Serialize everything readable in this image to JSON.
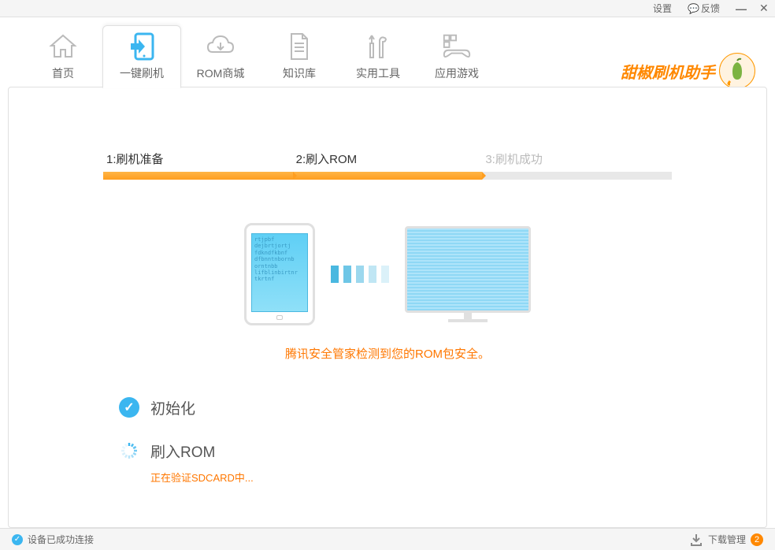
{
  "titlebar": {
    "settings": "设置",
    "feedback": "反馈"
  },
  "nav": {
    "tabs": [
      {
        "label": "首页"
      },
      {
        "label": "一键刷机"
      },
      {
        "label": "ROM商城"
      },
      {
        "label": "知识库"
      },
      {
        "label": "实用工具"
      },
      {
        "label": "应用游戏"
      }
    ]
  },
  "logo": {
    "text": "甜椒刷机助手"
  },
  "steps": [
    {
      "label": "1:刷机准备",
      "active": true
    },
    {
      "label": "2:刷入ROM",
      "active": true
    },
    {
      "label": "3:刷机成功",
      "active": false
    }
  ],
  "phone_text": "rtjpbf\ndejbrtjortj\nfdkndfkbnf\ndfbnntnbornb\norntnbb\nlifblinbirtnr\ntkrtnf",
  "security_msg": "腾讯安全管家检测到您的ROM包安全。",
  "status": {
    "init": "初始化",
    "flash": "刷入ROM",
    "flash_sub": "正在验证SDCARD中..."
  },
  "footer": {
    "connected": "设备已成功连接",
    "download_mgr": "下载管理",
    "badge_count": "2"
  }
}
